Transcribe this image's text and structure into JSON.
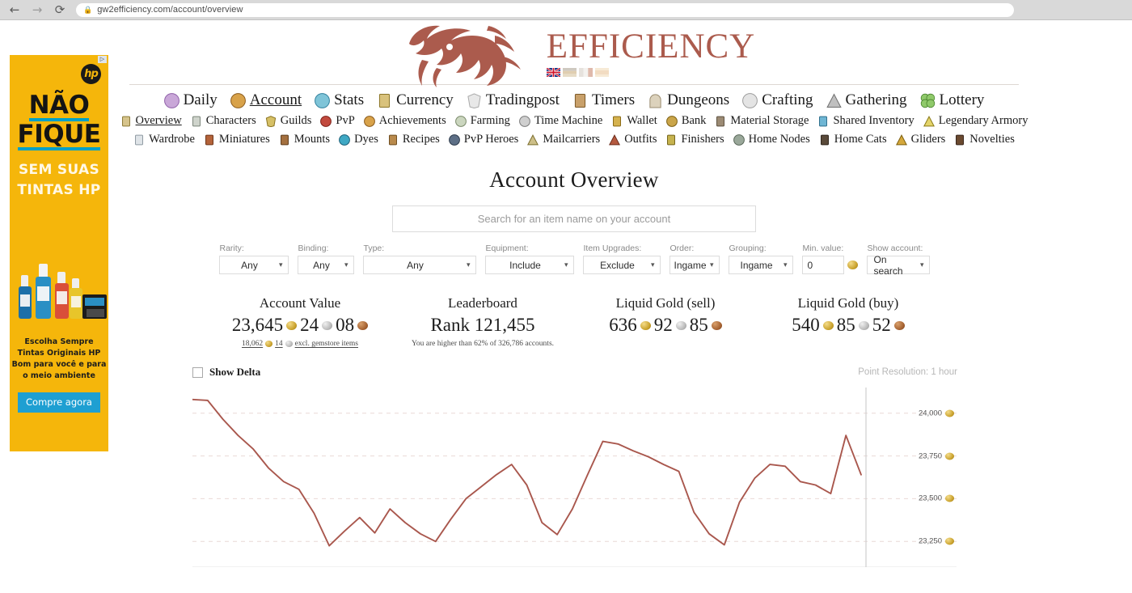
{
  "browser": {
    "back_icon": "arrow-left-icon",
    "forward_icon": "arrow-right-icon",
    "reload_icon": "reload-icon",
    "lock_icon": "lock-icon",
    "url": "gw2efficiency.com/account/overview"
  },
  "ad": {
    "adchoices_label": "▷",
    "logo": "hp",
    "headline_line1": "NÃO",
    "headline_line2": "FIQUE",
    "sub_line1": "SEM SUAS",
    "sub_line2": "TINTAS HP",
    "copy_line1": "Escolha Sempre",
    "copy_line2": "Tintas Originais HP",
    "copy_line3": "Bom para você e para",
    "copy_line4": "o meio ambiente",
    "cta": "Compre agora"
  },
  "header": {
    "brand": "EFFICIENCY",
    "logo_icon": "dragon-logo-icon",
    "flags": [
      "flag-en",
      "flag-de",
      "flag-fr",
      "flag-es"
    ]
  },
  "nav_primary": [
    {
      "label": "Daily",
      "icon": "daily-icon",
      "active": false
    },
    {
      "label": "Account",
      "icon": "account-icon",
      "active": true
    },
    {
      "label": "Stats",
      "icon": "stats-icon",
      "active": false
    },
    {
      "label": "Currency",
      "icon": "currency-icon",
      "active": false
    },
    {
      "label": "Tradingpost",
      "icon": "tradingpost-icon",
      "active": false
    },
    {
      "label": "Timers",
      "icon": "timers-icon",
      "active": false
    },
    {
      "label": "Dungeons",
      "icon": "dungeons-icon",
      "active": false
    },
    {
      "label": "Crafting",
      "icon": "crafting-icon",
      "active": false
    },
    {
      "label": "Gathering",
      "icon": "gathering-icon",
      "active": false
    },
    {
      "label": "Lottery",
      "icon": "lottery-icon",
      "active": false
    }
  ],
  "nav_secondary_row1": [
    {
      "label": "Overview",
      "icon": "overview-icon",
      "active": true
    },
    {
      "label": "Characters",
      "icon": "characters-icon",
      "active": false
    },
    {
      "label": "Guilds",
      "icon": "guilds-icon",
      "active": false
    },
    {
      "label": "PvP",
      "icon": "pvp-icon",
      "active": false
    },
    {
      "label": "Achievements",
      "icon": "achievements-icon",
      "active": false
    },
    {
      "label": "Farming",
      "icon": "farming-icon",
      "active": false
    },
    {
      "label": "Time Machine",
      "icon": "time-machine-icon",
      "active": false
    },
    {
      "label": "Wallet",
      "icon": "wallet-icon",
      "active": false
    },
    {
      "label": "Bank",
      "icon": "bank-icon",
      "active": false
    },
    {
      "label": "Material Storage",
      "icon": "material-storage-icon",
      "active": false
    },
    {
      "label": "Shared Inventory",
      "icon": "shared-inventory-icon",
      "active": false
    },
    {
      "label": "Legendary Armory",
      "icon": "legendary-armory-icon",
      "active": false
    }
  ],
  "nav_secondary_row2": [
    {
      "label": "Wardrobe",
      "icon": "wardrobe-icon",
      "active": false
    },
    {
      "label": "Miniatures",
      "icon": "miniatures-icon",
      "active": false
    },
    {
      "label": "Mounts",
      "icon": "mounts-icon",
      "active": false
    },
    {
      "label": "Dyes",
      "icon": "dyes-icon",
      "active": false
    },
    {
      "label": "Recipes",
      "icon": "recipes-icon",
      "active": false
    },
    {
      "label": "PvP Heroes",
      "icon": "pvp-heroes-icon",
      "active": false
    },
    {
      "label": "Mailcarriers",
      "icon": "mailcarriers-icon",
      "active": false
    },
    {
      "label": "Outfits",
      "icon": "outfits-icon",
      "active": false
    },
    {
      "label": "Finishers",
      "icon": "finishers-icon",
      "active": false
    },
    {
      "label": "Home Nodes",
      "icon": "home-nodes-icon",
      "active": false
    },
    {
      "label": "Home Cats",
      "icon": "home-cats-icon",
      "active": false
    },
    {
      "label": "Gliders",
      "icon": "gliders-icon",
      "active": false
    },
    {
      "label": "Novelties",
      "icon": "novelties-icon",
      "active": false
    }
  ],
  "main": {
    "title": "Account Overview",
    "search_placeholder": "Search for an item name on your account",
    "search_value": ""
  },
  "filters": [
    {
      "label": "Rarity:",
      "value": "Any",
      "width": "w-rarity"
    },
    {
      "label": "Binding:",
      "value": "Any",
      "width": "w-binding"
    },
    {
      "label": "Type:",
      "value": "Any",
      "width": "w-type"
    },
    {
      "label": "Equipment:",
      "value": "Include",
      "width": "w-equip"
    },
    {
      "label": "Item Upgrades:",
      "value": "Exclude",
      "width": "w-upg"
    },
    {
      "label": "Order:",
      "value": "Ingame",
      "width": "w-order"
    },
    {
      "label": "Grouping:",
      "value": "Ingame",
      "width": "w-group"
    }
  ],
  "min_value": {
    "label": "Min. value:",
    "value": "0",
    "coin_icon": "gold-coin-icon"
  },
  "show_account": {
    "label": "Show account:",
    "value": "On search",
    "width": "w-show"
  },
  "stats": [
    {
      "title": "Account Value",
      "gold": "23,645",
      "silver": "24",
      "copper": "08",
      "sub_gold": "18,062",
      "sub_silver": "14",
      "sub_text": "excl. gemstore items",
      "sub_underline": true
    },
    {
      "title": "Leaderboard",
      "rank": "Rank 121,455",
      "sub_text": "You are higher than 62% of 326,786 accounts."
    },
    {
      "title": "Liquid Gold (sell)",
      "gold": "636",
      "silver": "92",
      "copper": "85"
    },
    {
      "title": "Liquid Gold (buy)",
      "gold": "540",
      "silver": "85",
      "copper": "52"
    }
  ],
  "chart_controls": {
    "show_delta_label": "Show Delta",
    "show_delta_checked": false,
    "point_resolution": "Point Resolution: 1 hour"
  },
  "chart_data": {
    "type": "line",
    "title": "",
    "xlabel": "",
    "ylabel": "",
    "line_color": "#a9574d",
    "grid": true,
    "legend": false,
    "ylim": [
      23100,
      24150
    ],
    "yticks": [
      24000,
      23750,
      23500,
      23250
    ],
    "ytick_labels": [
      "24,000",
      "23,750",
      "23,500",
      "23,250"
    ],
    "ytick_suffix_icon": "gold-coin-icon",
    "point_resolution": "1 hour",
    "x": [
      0,
      1,
      2,
      3,
      4,
      5,
      6,
      7,
      8,
      9,
      10,
      11,
      12,
      13,
      14,
      15,
      16,
      17,
      18,
      19,
      20,
      21,
      22,
      23,
      24,
      25,
      26,
      27,
      28,
      29,
      30,
      31,
      32,
      33,
      34,
      35,
      36,
      37,
      38,
      39,
      40,
      41,
      42,
      43,
      44
    ],
    "values": [
      24080,
      24075,
      23965,
      23870,
      23790,
      23680,
      23600,
      23555,
      23415,
      23225,
      23310,
      23390,
      23300,
      23440,
      23360,
      23295,
      23250,
      23380,
      23500,
      23570,
      23640,
      23700,
      23580,
      23360,
      23290,
      23440,
      23640,
      23835,
      23820,
      23780,
      23745,
      23700,
      23660,
      23420,
      23295,
      23230,
      23480,
      23620,
      23700,
      23690,
      23600,
      23580,
      23530,
      23870,
      23640
    ],
    "y_first": 24080,
    "y_last": 23640,
    "y_max": 24080,
    "y_min": 23225
  }
}
